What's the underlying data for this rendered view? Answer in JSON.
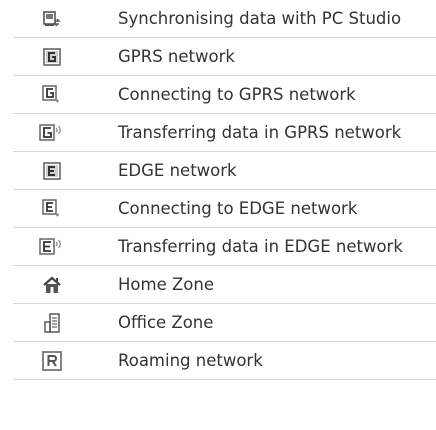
{
  "rows": [
    {
      "icon": "sync-pc-studio-icon",
      "label": "Synchronising data with PC Studio"
    },
    {
      "icon": "gprs-network-icon",
      "label": "GPRS network"
    },
    {
      "icon": "gprs-connecting-icon",
      "label": "Connecting to GPRS network"
    },
    {
      "icon": "gprs-transfer-icon",
      "label": "Transferring data in GPRS network"
    },
    {
      "icon": "edge-network-icon",
      "label": "EDGE network"
    },
    {
      "icon": "edge-connecting-icon",
      "label": "Connecting to EDGE network"
    },
    {
      "icon": "edge-transfer-icon",
      "label": "Transferring data in EDGE network"
    },
    {
      "icon": "home-zone-icon",
      "label": "Home Zone"
    },
    {
      "icon": "office-zone-icon",
      "label": "Office Zone"
    },
    {
      "icon": "roaming-icon",
      "label": "Roaming network"
    }
  ],
  "colors": {
    "text": "#333333",
    "divider": "#d6d6d6",
    "icon": "#555555"
  }
}
